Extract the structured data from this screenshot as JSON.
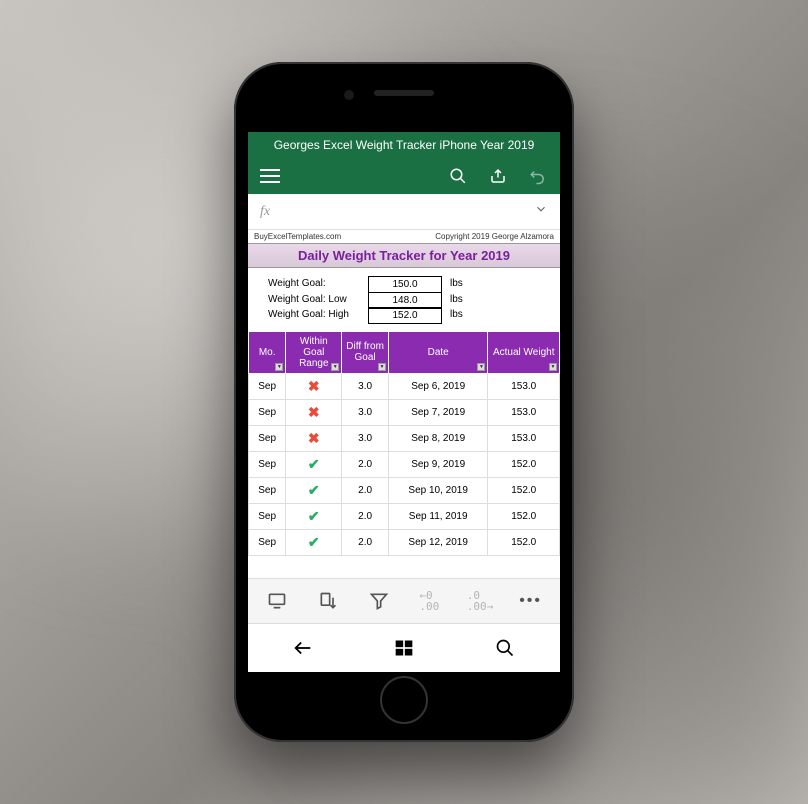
{
  "header": {
    "title": "Georges Excel Weight Tracker iPhone Year 2019"
  },
  "formula": {
    "fx": "fx"
  },
  "sheet": {
    "source": "BuyExcelTemplates.com",
    "copyright": "Copyright 2019  George Alzamora",
    "title": "Daily Weight Tracker for Year 2019"
  },
  "goals": [
    {
      "label": "Weight Goal:",
      "value": "150.0",
      "unit": "lbs"
    },
    {
      "label": "Weight Goal: Low",
      "value": "148.0",
      "unit": "lbs"
    },
    {
      "label": "Weight Goal: High",
      "value": "152.0",
      "unit": "lbs"
    }
  ],
  "columns": {
    "mo": "Mo.",
    "range": "Within Goal Range",
    "diff": "Diff from Goal",
    "date": "Date",
    "weight": "Actual Weight"
  },
  "rows": [
    {
      "mo": "Sep",
      "inRange": false,
      "diff": "3.0",
      "date": "Sep 6, 2019",
      "weight": "153.0"
    },
    {
      "mo": "Sep",
      "inRange": false,
      "diff": "3.0",
      "date": "Sep 7, 2019",
      "weight": "153.0"
    },
    {
      "mo": "Sep",
      "inRange": false,
      "diff": "3.0",
      "date": "Sep 8, 2019",
      "weight": "153.0"
    },
    {
      "mo": "Sep",
      "inRange": true,
      "diff": "2.0",
      "date": "Sep 9, 2019",
      "weight": "152.0"
    },
    {
      "mo": "Sep",
      "inRange": true,
      "diff": "2.0",
      "date": "Sep 10, 2019",
      "weight": "152.0"
    },
    {
      "mo": "Sep",
      "inRange": true,
      "diff": "2.0",
      "date": "Sep 11, 2019",
      "weight": "152.0"
    },
    {
      "mo": "Sep",
      "inRange": true,
      "diff": "2.0",
      "date": "Sep 12, 2019",
      "weight": "152.0"
    }
  ],
  "bottomToolbar": {
    "decimalDecrease": "←0\n.00",
    "decimalIncrease": ".0\n.00→"
  }
}
